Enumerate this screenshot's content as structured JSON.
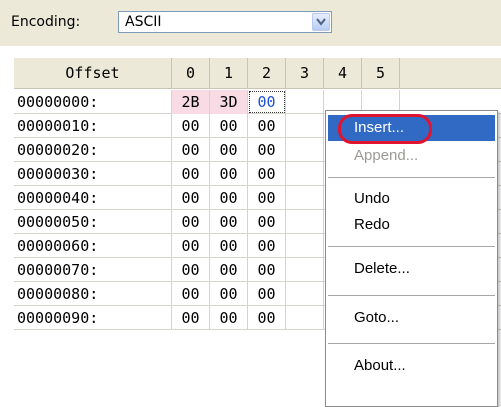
{
  "toolbar": {
    "encoding_label": "Encoding:",
    "encoding_value": "ASCII"
  },
  "grid": {
    "columns": [
      "Offset",
      "0",
      "1",
      "2",
      "3",
      "4",
      "5"
    ],
    "rows": [
      {
        "offset": "00000000:",
        "bytes": [
          "2B",
          "3D",
          "00",
          "",
          "",
          ""
        ]
      },
      {
        "offset": "00000010:",
        "bytes": [
          "00",
          "00",
          "00",
          "",
          "",
          ""
        ]
      },
      {
        "offset": "00000020:",
        "bytes": [
          "00",
          "00",
          "00",
          "",
          "",
          ""
        ]
      },
      {
        "offset": "00000030:",
        "bytes": [
          "00",
          "00",
          "00",
          "",
          "",
          ""
        ]
      },
      {
        "offset": "00000040:",
        "bytes": [
          "00",
          "00",
          "00",
          "",
          "",
          ""
        ]
      },
      {
        "offset": "00000050:",
        "bytes": [
          "00",
          "00",
          "00",
          "",
          "",
          ""
        ]
      },
      {
        "offset": "00000060:",
        "bytes": [
          "00",
          "00",
          "00",
          "",
          "",
          ""
        ]
      },
      {
        "offset": "00000070:",
        "bytes": [
          "00",
          "00",
          "00",
          "",
          "",
          ""
        ]
      },
      {
        "offset": "00000080:",
        "bytes": [
          "00",
          "00",
          "00",
          "",
          "",
          ""
        ]
      },
      {
        "offset": "00000090:",
        "bytes": [
          "00",
          "00",
          "00",
          "",
          "",
          ""
        ]
      }
    ]
  },
  "menu": {
    "items": [
      {
        "label": "Insert...",
        "state": "highlighted"
      },
      {
        "label": "Append...",
        "state": "disabled"
      },
      {
        "label": "Undo",
        "state": "normal"
      },
      {
        "label": "Redo",
        "state": "normal"
      },
      {
        "label": "Delete...",
        "state": "normal"
      },
      {
        "label": "Goto...",
        "state": "normal"
      },
      {
        "label": "About...",
        "state": "normal"
      }
    ]
  },
  "colors": {
    "highlight": "#316ac5",
    "modified_cell": "#f9dbe6",
    "annotation_ring": "#e0142e"
  }
}
